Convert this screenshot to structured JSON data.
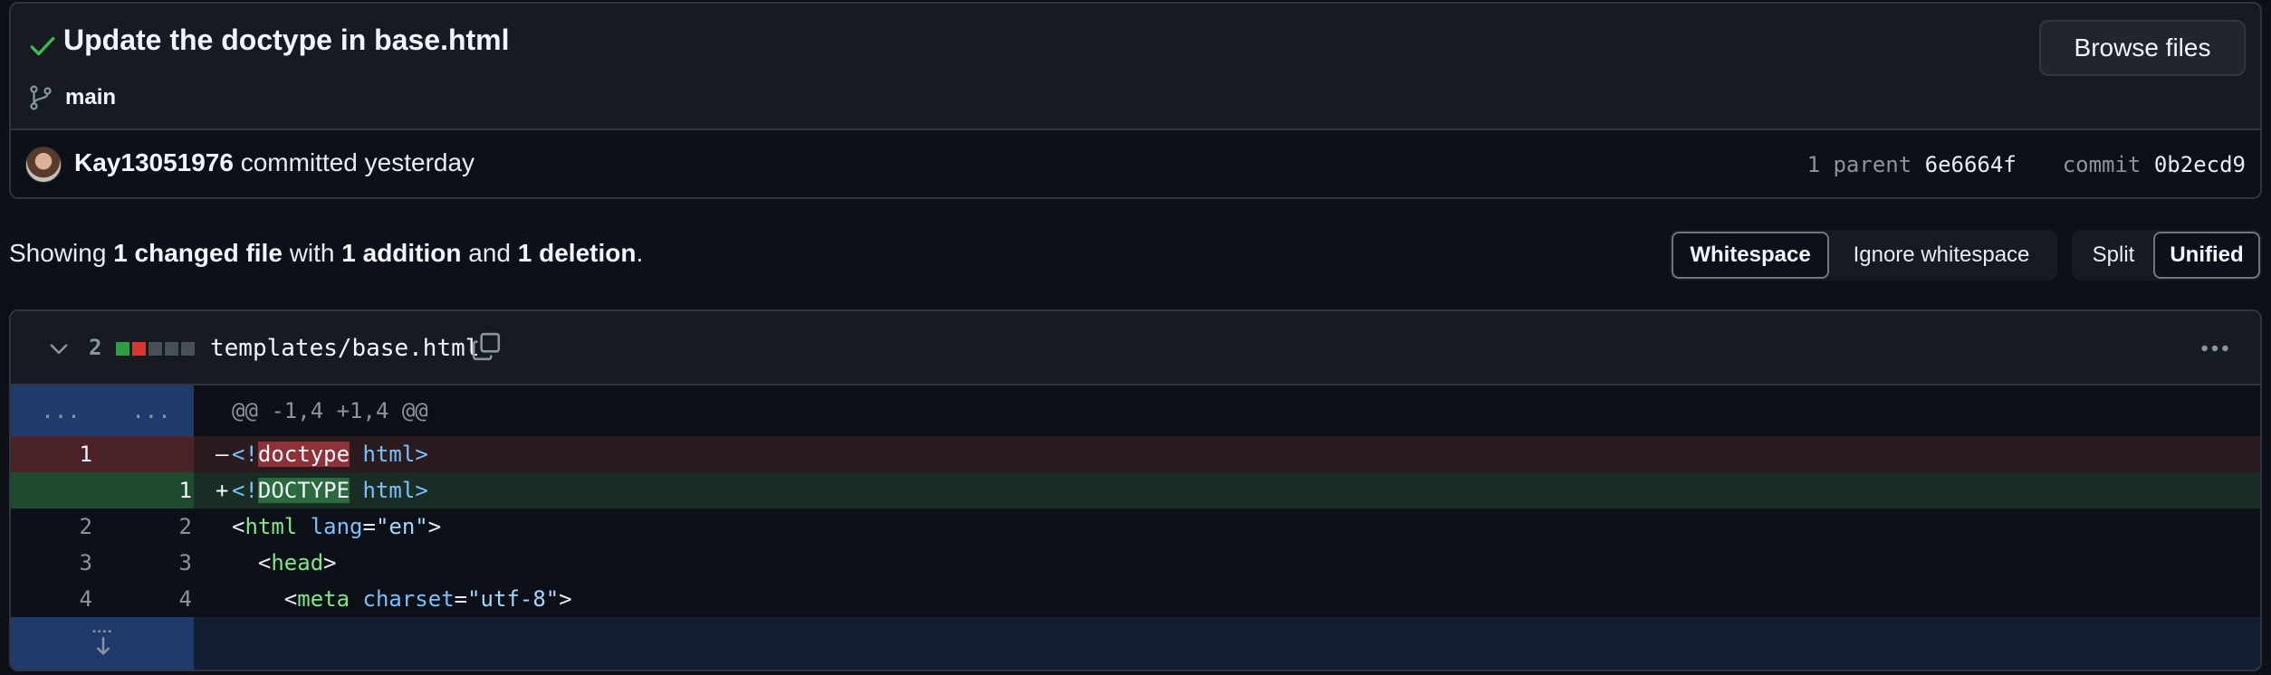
{
  "commit": {
    "title": "Update the doctype in base.html",
    "branch": "main",
    "browse_label": "Browse files",
    "author": "Kay13051976",
    "action": "committed yesterday",
    "parent_label": "1 parent",
    "parent_sha": "6e6664f",
    "commit_label": "commit",
    "commit_sha": "0b2ecd9"
  },
  "summary": {
    "prefix": "Showing",
    "changed": "1 changed file",
    "with": "with",
    "additions": "1 addition",
    "and": "and",
    "deletions": "1 deletion",
    "suffix": "."
  },
  "view_options": {
    "whitespace": "Whitespace",
    "ignore_whitespace": "Ignore whitespace",
    "split": "Split",
    "unified": "Unified",
    "active_whitespace": "Whitespace",
    "active_layout": "Unified"
  },
  "file": {
    "change_count": "2",
    "path": "templates/base.html",
    "diffstat": [
      "#2ea043",
      "#da3633",
      "#484f58",
      "#484f58",
      "#484f58"
    ]
  },
  "diff": {
    "hunk_dots": "...",
    "hunk_header": "@@ -1,4 +1,4 @@",
    "del_line_old": "1",
    "del_sign": "–",
    "del_open": "<!",
    "del_word": "doctype",
    "del_rest": "html",
    "del_close": ">",
    "add_line_new": "1",
    "add_sign": "+",
    "add_open": "<!",
    "add_word": "DOCTYPE",
    "add_rest": "html",
    "add_close": ">",
    "ctx": [
      {
        "old": "2",
        "new": "2"
      },
      {
        "old": "3",
        "new": "3"
      },
      {
        "old": "4",
        "new": "4"
      }
    ],
    "l2": {
      "lt": "<",
      "tag": "html",
      "attr": "lang",
      "eq": "=",
      "val": "\"en\"",
      "gt": ">"
    },
    "l3": {
      "lt": "<",
      "tag": "head",
      "gt": ">"
    },
    "l4": {
      "lt": "<",
      "tag": "meta",
      "attr": "charset",
      "eq": "=",
      "val": "\"utf-8\"",
      "gt": ">"
    }
  },
  "icons": {
    "check": "check-icon",
    "branch": "git-branch-icon",
    "chevron": "chevron-down-icon",
    "copy": "copy-icon",
    "kebab": "kebab-horizontal-icon",
    "expand": "unfold-down-icon"
  }
}
